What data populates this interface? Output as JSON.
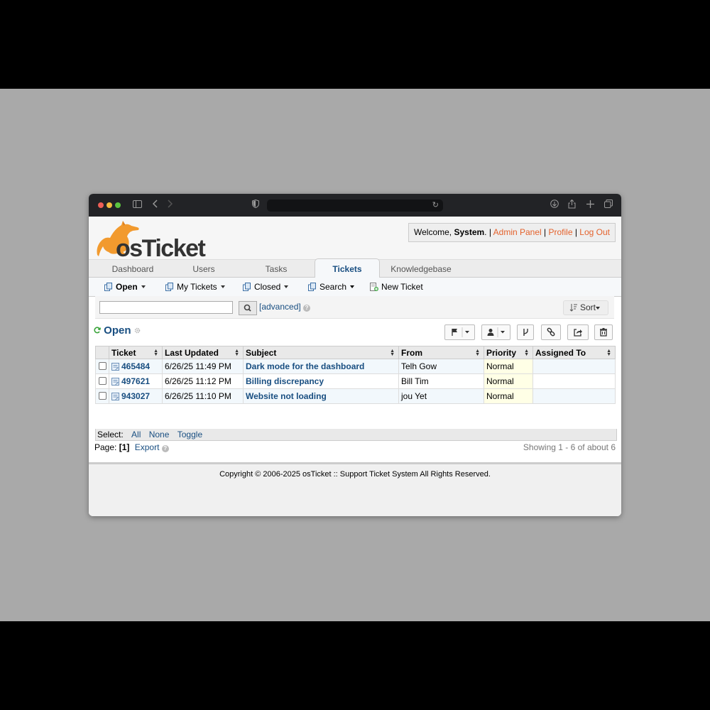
{
  "app": {
    "brand_logo": "osTicket"
  },
  "userbar": {
    "welcome": "Welcome, ",
    "user": "System",
    "period": ".",
    "sep": " | ",
    "admin_panel": "Admin Panel",
    "profile": "Profile",
    "logout": "Log Out"
  },
  "tabs": [
    {
      "label": "Dashboard"
    },
    {
      "label": "Users"
    },
    {
      "label": "Tasks"
    },
    {
      "label": "Tickets",
      "active": true
    },
    {
      "label": "Knowledgebase"
    }
  ],
  "subnav": {
    "open": "Open",
    "my_tickets": "My Tickets",
    "closed": "Closed",
    "search": "Search",
    "new_ticket": "New Ticket"
  },
  "search": {
    "placeholder": "",
    "value": "",
    "advanced": "[advanced]",
    "sort": "Sort"
  },
  "page": {
    "title": "Open"
  },
  "table": {
    "headers": [
      "Ticket",
      "Last Updated",
      "Subject",
      "From",
      "Priority",
      "Assigned To"
    ],
    "rows": [
      {
        "ticket": "465484",
        "updated": "6/26/25 11:49 PM",
        "subject": "Dark mode for the dashboard",
        "from": "Telh Gow",
        "priority": "Normal",
        "assigned": ""
      },
      {
        "ticket": "497621",
        "updated": "6/26/25 11:12 PM",
        "subject": "Billing discrepancy",
        "from": "Bill Tim",
        "priority": "Normal",
        "assigned": ""
      },
      {
        "ticket": "943027",
        "updated": "6/26/25 11:10 PM",
        "subject": "Website not loading",
        "from": "jou Yet",
        "priority": "Normal",
        "assigned": ""
      }
    ]
  },
  "select": {
    "label": "Select:",
    "all": "All",
    "none": "None",
    "toggle": "Toggle"
  },
  "pager": {
    "page_label": "Page:",
    "page_current": "[1]",
    "export": "Export",
    "showing": "Showing 1 - 6 of about 6"
  },
  "footer": {
    "copyright": "Copyright © 2006-2025 osTicket :: Support Ticket System All Rights Reserved."
  },
  "colors": {
    "brand_orange": "#e4622c",
    "link_blue": "#184e81"
  }
}
